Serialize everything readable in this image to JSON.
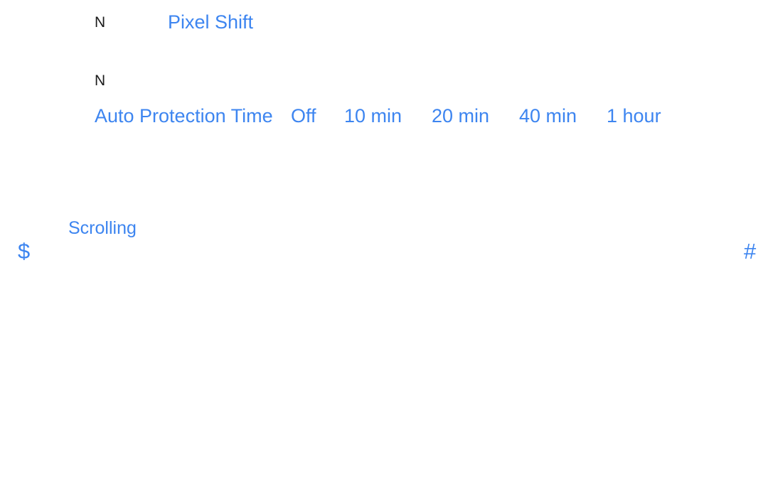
{
  "screen": {
    "background_color": "#ffffff",
    "accent_color": "#3d85f0",
    "marker_color": "#1a1a1a"
  },
  "settings_panel": {
    "pixel_shift": {
      "marker": "N",
      "label": "Pixel Shift"
    },
    "auto_protection": {
      "marker": "N",
      "label": "Auto Protection Time",
      "options": [
        {
          "label": "Off"
        },
        {
          "label": "10 min"
        },
        {
          "label": "20 min"
        },
        {
          "label": "40 min"
        },
        {
          "label": "1 hour"
        }
      ]
    },
    "scrolling": {
      "label": "Scrolling"
    }
  },
  "edge_glyphs": {
    "left": "$",
    "right": "#"
  }
}
